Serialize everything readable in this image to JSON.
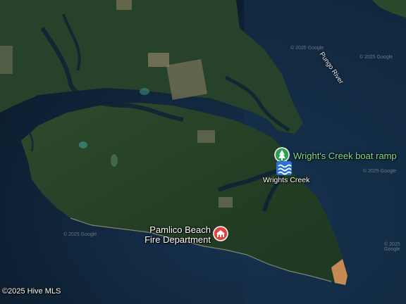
{
  "map": {
    "type": "satellite",
    "colors": {
      "water_deep": "#0e2033",
      "water_mid": "#14304a",
      "forest_dark": "#1d3a22",
      "forest": "#2c4d2a",
      "fields": "#7a6f55",
      "shore_sand": "#d9935a"
    },
    "labels": {
      "boat_ramp": "Wright's Creek boat ramp",
      "place": "Wrights Creek",
      "river": "Pungo River",
      "fire_line1": "Pamlico Beach",
      "fire_line2": "Fire Department"
    },
    "icons": {
      "boat_ramp": "tree-pin-icon",
      "fire": "fire-station-pin-icon",
      "water": "water-waves-icon"
    },
    "copyright": "©2025 Hive MLS"
  }
}
